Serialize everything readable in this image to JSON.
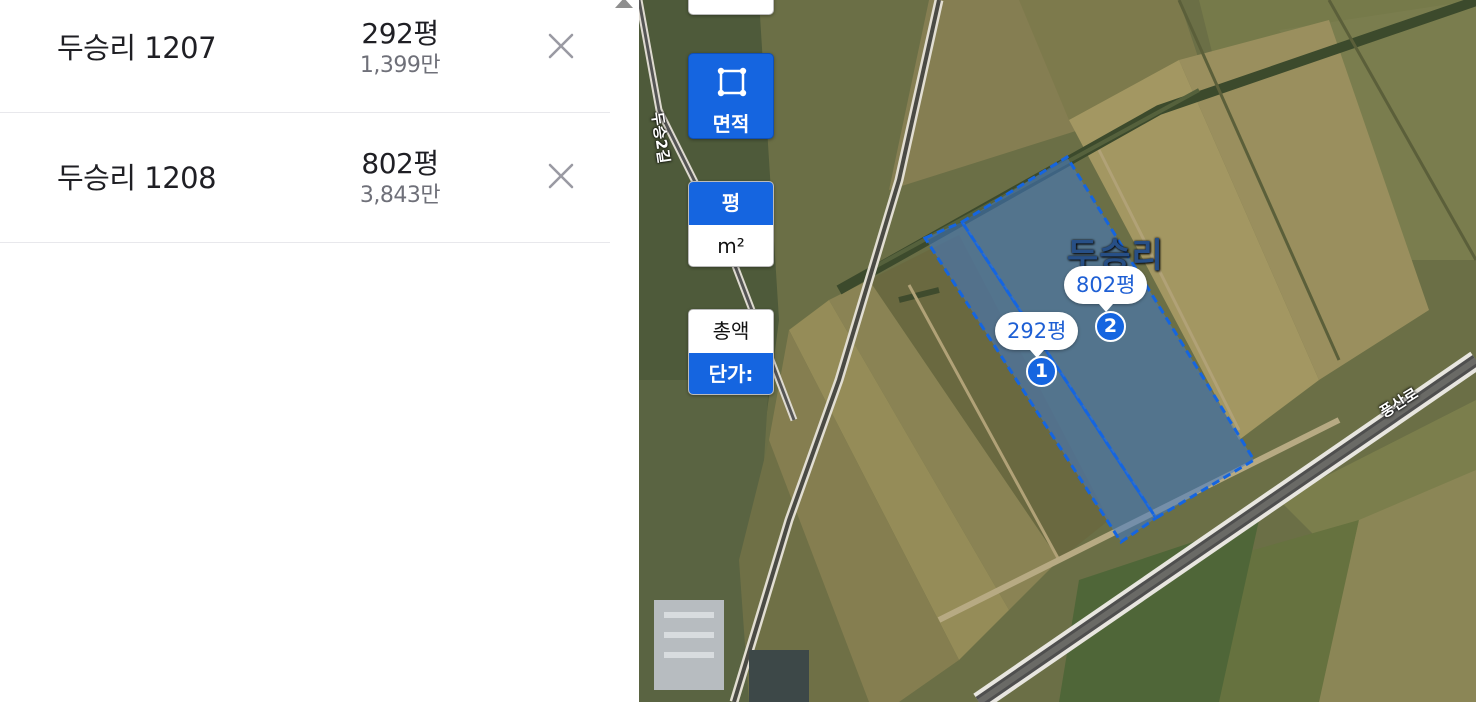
{
  "parcels": [
    {
      "name": "두승리 1207",
      "area": "292평",
      "price": "1,399만"
    },
    {
      "name": "두승리 1208",
      "area": "802평",
      "price": "3,843만"
    }
  ],
  "controls": {
    "area_label": "면적",
    "unit_pyeong": "평",
    "unit_m2": "m²",
    "total_label": "총액",
    "unit_price_label": "단가:"
  },
  "map": {
    "village_label": "두승리",
    "road_label_1": "두승2길",
    "road_label_2": "풍산로",
    "markers": [
      {
        "number": "1",
        "area": "292평"
      },
      {
        "number": "2",
        "area": "802평"
      }
    ]
  },
  "colors": {
    "accent": "#1565e0",
    "parcel_fill": "#3f78c8",
    "parcel_stroke": "#1565e0"
  }
}
